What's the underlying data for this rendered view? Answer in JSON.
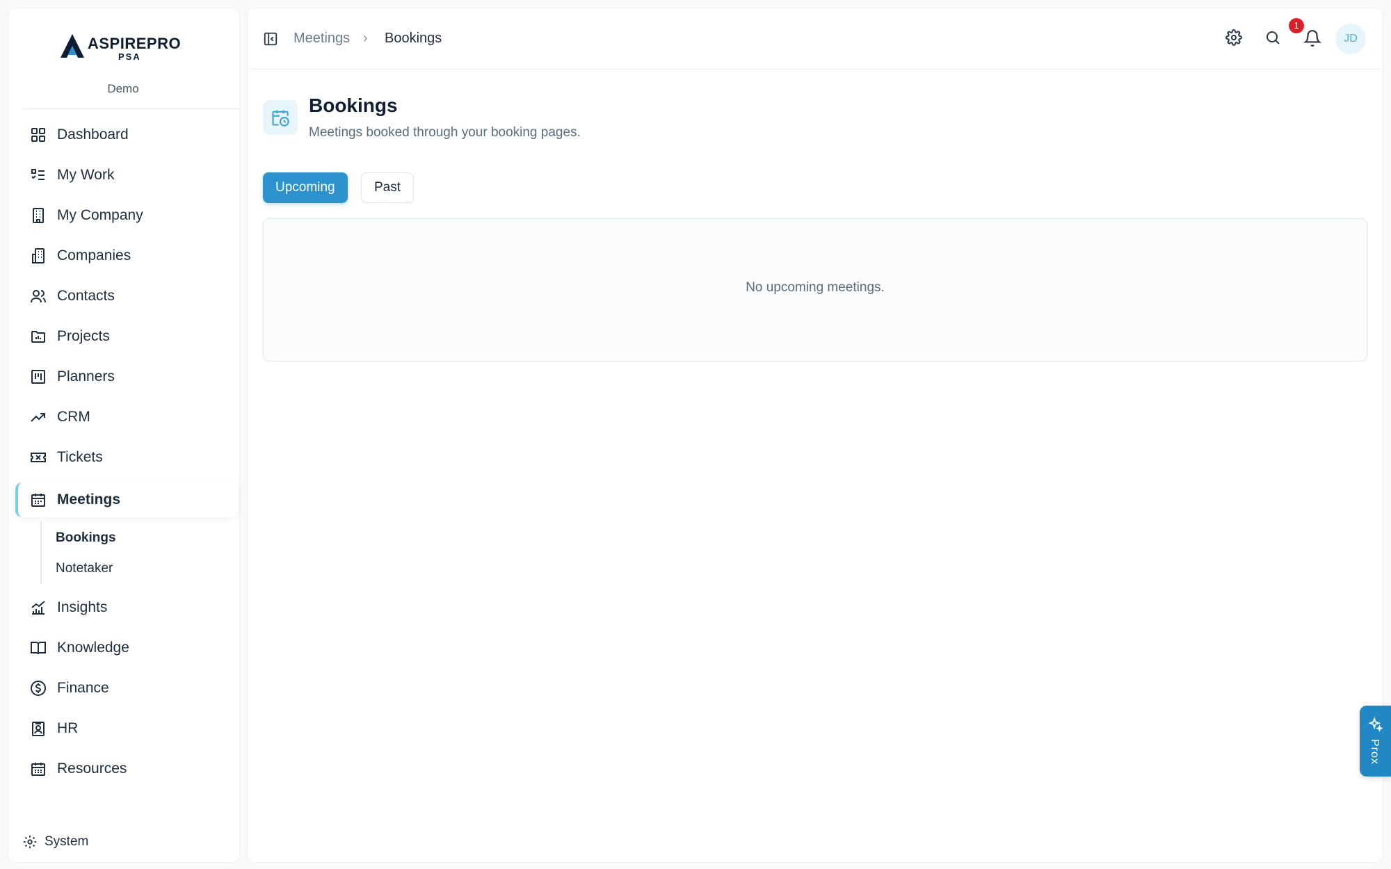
{
  "brand": {
    "name": "ASPIREPRO",
    "sub": "PSA",
    "tenant": "Demo"
  },
  "nav": {
    "items": [
      {
        "label": "Dashboard",
        "icon": "grid-icon"
      },
      {
        "label": "My Work",
        "icon": "checklist-icon"
      },
      {
        "label": "My Company",
        "icon": "building-icon"
      },
      {
        "label": "Companies",
        "icon": "buildings-icon"
      },
      {
        "label": "Contacts",
        "icon": "users-icon"
      },
      {
        "label": "Projects",
        "icon": "folder-chart-icon"
      },
      {
        "label": "Planners",
        "icon": "kanban-icon"
      },
      {
        "label": "CRM",
        "icon": "trending-up-icon"
      },
      {
        "label": "Tickets",
        "icon": "ticket-icon"
      },
      {
        "label": "Meetings",
        "icon": "calendar-icon",
        "active": true
      },
      {
        "label": "Insights",
        "icon": "bar-chart-icon"
      },
      {
        "label": "Knowledge",
        "icon": "book-icon"
      },
      {
        "label": "Finance",
        "icon": "dollar-circle-icon"
      },
      {
        "label": "HR",
        "icon": "id-badge-icon"
      },
      {
        "label": "Resources",
        "icon": "calendar-grid-icon"
      }
    ],
    "subitems": [
      {
        "label": "Bookings",
        "current": true
      },
      {
        "label": "Notetaker",
        "current": false
      }
    ],
    "system_label": "System"
  },
  "topbar": {
    "breadcrumb_parent": "Meetings",
    "breadcrumb_separator": "›",
    "breadcrumb_current": "Bookings",
    "notification_count": "1",
    "avatar_initials": "JD"
  },
  "page": {
    "title": "Bookings",
    "subtitle": "Meetings booked through your booking pages.",
    "tabs": [
      {
        "label": "Upcoming",
        "active": true
      },
      {
        "label": "Past",
        "active": false
      }
    ],
    "empty_message": "No upcoming meetings."
  },
  "assistant": {
    "label": "Prox"
  },
  "colors": {
    "accent": "#2c93cf",
    "badge": "#e11d2a",
    "brand_text": "#0f1d35"
  }
}
